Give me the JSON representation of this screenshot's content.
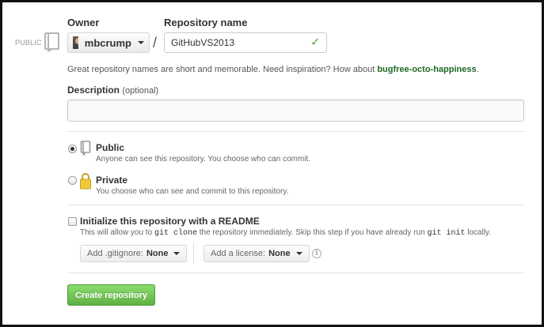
{
  "owner": {
    "label": "Owner",
    "selected": "mbcrump"
  },
  "repo_name": {
    "label": "Repository name",
    "value": "GitHubVS2013"
  },
  "public_tag": "PUBLIC",
  "separator": "/",
  "hint": {
    "text": "Great repository names are short and memorable. Need inspiration? How about",
    "suggestion": "bugfree-octo-happiness",
    "end": "."
  },
  "description": {
    "label": "Description",
    "optional": "(optional)",
    "value": ""
  },
  "visibility": [
    {
      "title": "Public",
      "desc": "Anyone can see this repository. You choose who can commit.",
      "selected": true
    },
    {
      "title": "Private",
      "desc": "You choose who can see and commit to this repository.",
      "selected": false
    }
  ],
  "readme": {
    "label": "Initialize this repository with a README",
    "desc_1": "This will allow you to",
    "code_1": "git clone",
    "desc_2": "the repository immediately. Skip this step if you have already run",
    "code_2": "git init",
    "desc_3": "locally.",
    "checked": false
  },
  "gitignore": {
    "label": "Add .gitignore:",
    "value": "None"
  },
  "license": {
    "label": "Add a license:",
    "value": "None"
  },
  "create_button": "Create repository",
  "colors": {
    "accent_green": "#55a532",
    "suggestion_green": "#1e6823",
    "button_green": "#60b044"
  },
  "icons": {
    "repo": "repo-book-icon",
    "lock": "lock-icon",
    "valid": "checkmark-icon",
    "info": "info-icon"
  }
}
